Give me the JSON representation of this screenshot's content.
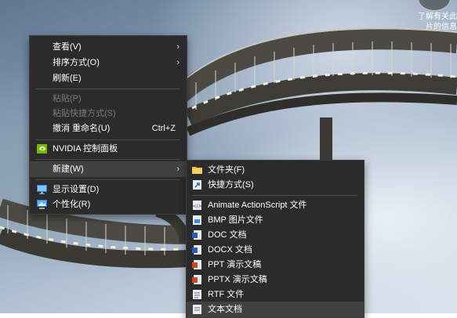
{
  "notification": {
    "line1": "了解有关此",
    "line2": "片的信息"
  },
  "context_menu": {
    "items": [
      {
        "label": "查看(V)",
        "submenu": true
      },
      {
        "label": "排序方式(O)",
        "submenu": true
      },
      {
        "label": "刷新(E)"
      },
      {
        "label": "粘贴(P)",
        "disabled": true
      },
      {
        "label": "粘贴快捷方式(S)",
        "disabled": true
      },
      {
        "label": "撤消 重命名(U)",
        "shortcut": "Ctrl+Z"
      },
      {
        "label": "NVIDIA 控制面板",
        "icon": "nvidia-icon"
      },
      {
        "label": "新建(W)",
        "submenu": true,
        "highlighted": true
      },
      {
        "label": "显示设置(D)",
        "icon": "display-settings-icon"
      },
      {
        "label": "个性化(R)",
        "icon": "personalize-icon"
      }
    ]
  },
  "new_submenu": {
    "items": [
      {
        "label": "文件夹(F)",
        "icon": "folder-icon"
      },
      {
        "label": "快捷方式(S)",
        "icon": "shortcut-icon"
      },
      {
        "label": "Animate ActionScript 文件",
        "icon": "actionscript-file-icon"
      },
      {
        "label": "BMP 图片文件",
        "icon": "bmp-file-icon"
      },
      {
        "label": "DOC 文档",
        "icon": "doc-file-icon"
      },
      {
        "label": "DOCX 文档",
        "icon": "docx-file-icon"
      },
      {
        "label": "PPT 演示文稿",
        "icon": "ppt-file-icon"
      },
      {
        "label": "PPTX 演示文稿",
        "icon": "pptx-file-icon"
      },
      {
        "label": "RTF 文件",
        "icon": "rtf-file-icon"
      },
      {
        "label": "文本文档",
        "icon": "text-file-icon",
        "highlighted": true
      }
    ]
  },
  "colors": {
    "menu_bg": "#2b2b2b",
    "highlight": "#414141",
    "disabled_text": "#7c7c7c"
  }
}
